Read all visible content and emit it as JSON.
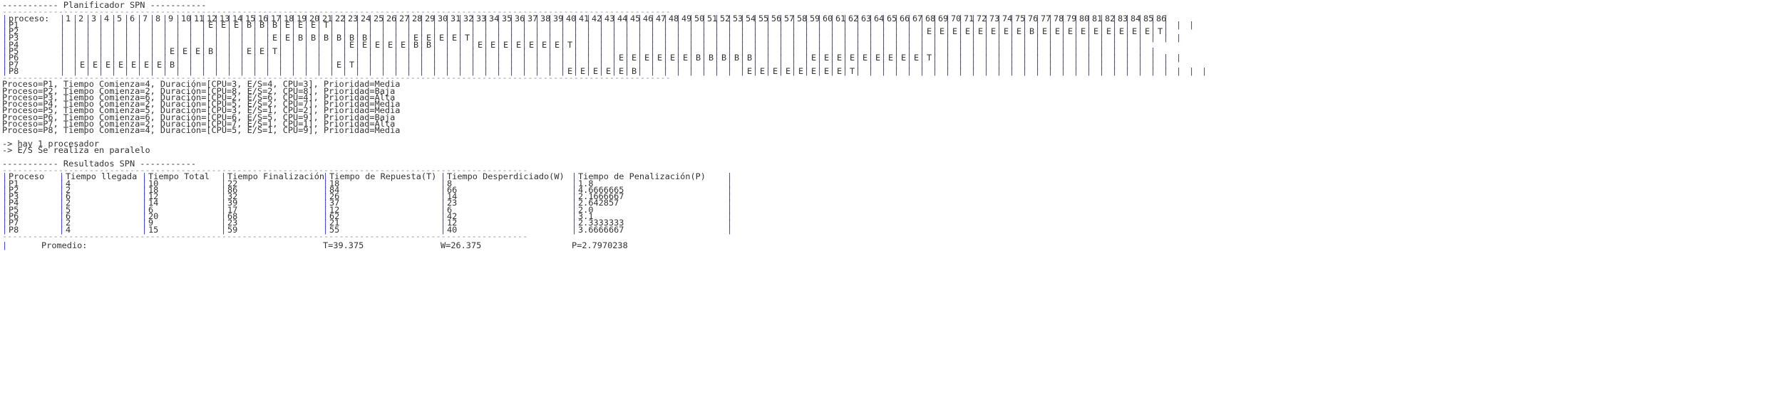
{
  "title_line": "----------- Planificador SPN -----------",
  "gantt": {
    "separator": "-----------------------------------------------------------------------------------------------------------------------------------",
    "header_label": "proceso:",
    "ticks": [
      "1",
      "2",
      "3",
      "4",
      "5",
      "6",
      "7",
      "8",
      "9",
      "10",
      "11",
      "12",
      "13",
      "14",
      "15",
      "16",
      "17",
      "18",
      "19",
      "20",
      "21",
      "22",
      "23",
      "24",
      "25",
      "26",
      "27",
      "28",
      "29",
      "30",
      "31",
      "32",
      "33",
      "34",
      "35",
      "36",
      "37",
      "38",
      "39",
      "40",
      "41",
      "42",
      "43",
      "44",
      "45",
      "46",
      "47",
      "48",
      "49",
      "50",
      "51",
      "52",
      "53",
      "54",
      "55",
      "56",
      "57",
      "58",
      "59",
      "60",
      "61",
      "62",
      "63",
      "64",
      "65",
      "66",
      "67",
      "68",
      "69",
      "70",
      "71",
      "72",
      "73",
      "74",
      "75",
      "76",
      "77",
      "78",
      "79",
      "80",
      "81",
      "82",
      "83",
      "84",
      "85",
      "86"
    ],
    "rows": [
      {
        "name": "P1",
        "cells": [
          "",
          "",
          "",
          "",
          "",
          "",
          "",
          "",
          "",
          "",
          "",
          "E",
          "E",
          "E",
          "B",
          "B",
          "B",
          "E",
          "E",
          "E",
          "T",
          "",
          "",
          "",
          "",
          "",
          "",
          "",
          "",
          "",
          "",
          "",
          "",
          "",
          "",
          "",
          "",
          "",
          "",
          "",
          "",
          "",
          "",
          "",
          "",
          "",
          "",
          "",
          "",
          "",
          "",
          "",
          "",
          "",
          "",
          "",
          "",
          "",
          "",
          "",
          "",
          "",
          "",
          "",
          "",
          "",
          "",
          "",
          "",
          "",
          "",
          "",
          "",
          "",
          "",
          "",
          "",
          "",
          "",
          "",
          "",
          "",
          "",
          "",
          "",
          "",
          "",
          ""
        ]
      },
      {
        "name": "P2",
        "cells": [
          "",
          "",
          "",
          "",
          "",
          "",
          "",
          "",
          "",
          "",
          "",
          "",
          "",
          "",
          "",
          "",
          "",
          "",
          "",
          "",
          "",
          "",
          "",
          "",
          "",
          "",
          "",
          "",
          "",
          "",
          "",
          "",
          "",
          "",
          "",
          "",
          "",
          "",
          "",
          "",
          "",
          "",
          "",
          "",
          "",
          "",
          "",
          "",
          "",
          "",
          "",
          "",
          "",
          "",
          "",
          "",
          "",
          "",
          "",
          "",
          "",
          "",
          "",
          "",
          "",
          "",
          "",
          "E",
          "E",
          "E",
          "E",
          "E",
          "E",
          "E",
          "E",
          "B",
          "E",
          "E",
          "E",
          "E",
          "E",
          "E",
          "E",
          "E",
          "E",
          "T"
        ]
      },
      {
        "name": "P3",
        "cells": [
          "",
          "",
          "",
          "",
          "",
          "",
          "",
          "",
          "",
          "",
          "",
          "",
          "",
          "",
          "",
          "",
          "E",
          "E",
          "B",
          "B",
          "B",
          "B",
          "B",
          "B",
          "",
          "",
          "",
          "E",
          "E",
          "E",
          "E",
          "T",
          "",
          "",
          "",
          "",
          "",
          "",
          "",
          "",
          "",
          "",
          "",
          "",
          "",
          "",
          "",
          "",
          "",
          "",
          "",
          "",
          "",
          "",
          "",
          "",
          "",
          "",
          "",
          "",
          "",
          "",
          "",
          "",
          "",
          "",
          "",
          "",
          "",
          "",
          "",
          "",
          "",
          "",
          "",
          "",
          "",
          "",
          "",
          "",
          "",
          "",
          "",
          "",
          "",
          "",
          ""
        ]
      },
      {
        "name": "P4",
        "cells": [
          "",
          "",
          "",
          "",
          "",
          "",
          "",
          "",
          "",
          "",
          "",
          "",
          "",
          "",
          "",
          "",
          "",
          "",
          "",
          "",
          "",
          "",
          "E",
          "E",
          "E",
          "E",
          "E",
          "B",
          "B",
          "",
          "",
          "",
          "E",
          "E",
          "E",
          "E",
          "E",
          "E",
          "E",
          "T",
          "",
          "",
          "",
          "",
          "",
          "",
          "",
          "",
          "",
          "",
          "",
          "",
          "",
          "",
          "",
          "",
          "",
          "",
          "",
          "",
          "",
          "",
          "",
          "",
          "",
          "",
          "",
          "",
          "",
          "",
          "",
          "",
          "",
          "",
          "",
          "",
          "",
          "",
          "",
          "",
          "",
          "",
          "",
          ""
        ]
      },
      {
        "name": "P5",
        "cells": [
          "",
          "",
          "",
          "",
          "",
          "",
          "",
          "",
          "E",
          "E",
          "E",
          "B",
          "",
          "",
          "E",
          "E",
          "T",
          "",
          "",
          "",
          "",
          "",
          "",
          "",
          "",
          "",
          "",
          "",
          "",
          "",
          "",
          "",
          "",
          "",
          "",
          "",
          "",
          "",
          "",
          "",
          "",
          "",
          "",
          "",
          "",
          "",
          "",
          "",
          "",
          "",
          "",
          "",
          "",
          "",
          "",
          "",
          "",
          "",
          "",
          "",
          "",
          "",
          "",
          "",
          "",
          "",
          "",
          "",
          "",
          "",
          "",
          "",
          "",
          "",
          "",
          "",
          "",
          "",
          "",
          "",
          "",
          "",
          "",
          "",
          ""
        ]
      },
      {
        "name": "P6",
        "cells": [
          "",
          "",
          "",
          "",
          "",
          "",
          "",
          "",
          "",
          "",
          "",
          "",
          "",
          "",
          "",
          "",
          "",
          "",
          "",
          "",
          "",
          "",
          "",
          "",
          "",
          "",
          "",
          "",
          "",
          "",
          "",
          "",
          "",
          "",
          "",
          "",
          "",
          "",
          "",
          "",
          "",
          "",
          "",
          "E",
          "E",
          "E",
          "E",
          "E",
          "E",
          "B",
          "B",
          "B",
          "B",
          "B",
          "",
          "",
          "",
          "",
          "E",
          "E",
          "E",
          "E",
          "E",
          "E",
          "E",
          "E",
          "E",
          "T",
          "",
          "",
          "",
          "",
          "",
          "",
          "",
          "",
          "",
          "",
          "",
          "",
          "",
          "",
          "",
          "",
          "",
          "",
          ""
        ]
      },
      {
        "name": "P7",
        "cells": [
          "",
          "E",
          "E",
          "E",
          "E",
          "E",
          "E",
          "E",
          "B",
          "",
          "",
          "",
          "",
          "",
          "",
          "",
          "",
          "",
          "",
          "",
          "",
          "E",
          "T",
          "",
          "",
          "",
          "",
          "",
          "",
          "",
          "",
          "",
          "",
          "",
          "",
          "",
          "",
          "",
          "",
          "",
          "",
          "",
          "",
          "",
          "",
          "",
          "",
          "",
          "",
          "",
          "",
          "",
          "",
          "",
          "",
          "",
          "",
          "",
          "",
          "",
          "",
          "",
          "",
          "",
          "",
          "",
          "",
          "",
          "",
          "",
          "",
          "",
          "",
          "",
          "",
          "",
          "",
          "",
          "",
          "",
          "",
          "",
          "",
          "",
          "",
          ""
        ]
      },
      {
        "name": "P8",
        "cells": [
          "",
          "",
          "",
          "",
          "",
          "",
          "",
          "",
          "",
          "",
          "",
          "",
          "",
          "",
          "",
          "",
          "",
          "",
          "",
          "",
          "",
          "",
          "",
          "",
          "",
          "",
          "",
          "",
          "",
          "",
          "",
          "",
          "",
          "",
          "",
          "",
          "",
          "",
          "",
          "E",
          "E",
          "E",
          "E",
          "E",
          "B",
          "",
          "",
          "",
          "",
          "",
          "",
          "",
          "",
          "E",
          "E",
          "E",
          "E",
          "E",
          "E",
          "E",
          "E",
          "T",
          "",
          "",
          "",
          "",
          "",
          "",
          "",
          "",
          "",
          "",
          "",
          "",
          "",
          "",
          "",
          "",
          "",
          "",
          "",
          "",
          "",
          "",
          "",
          "",
          "",
          "",
          ""
        ]
      }
    ]
  },
  "process_lines": [
    "Proceso=P1, Tiempo Comienza=4, Duración=[CPU=3, E/S=4, CPU=3], Prioridad=Media",
    "Proceso=P2, Tiempo Comienza=2, Duración=[CPU=8, E/S=2, CPU=8], Prioridad=Baja",
    "Proceso=P3, Tiempo Comienza=6, Duración=[CPU=2, E/S=6, CPU=4], Prioridad=Alta",
    "Proceso=P4, Tiempo Comienza=2, Duración=[CPU=5, E/S=2, CPU=7], Prioridad=Media",
    "Proceso=P5, Tiempo Comienza=5, Duración=[CPU=3, E/S=1, CPU=2], Prioridad=Media",
    "Proceso=P6, Tiempo Comienza=6, Duración=[CPU=6, E/S=5, CPU=9], Prioridad=Baja",
    "Proceso=P7, Tiempo Comienza=2, Duración=[CPU=7, E/S=1, CPU=1], Prioridad=Alta",
    "Proceso=P8, Tiempo Comienza=4, Duración=[CPU=5, E/S=1, CPU=9], Prioridad=Media"
  ],
  "notes": [
    "-> hay 1 procesador",
    "-> E/S Se realiza en paralelo"
  ],
  "results": {
    "title_line": "----------- Resultados SPN -----------",
    "separator": "-------------------------------------------------------------------------------------------------------",
    "headers": [
      "Proceso",
      "Tiempo llegada",
      "Tiempo Total",
      "Tiempo Finalización",
      "Tiempo de Repuesta(T)",
      "Tiempo Desperdiciado(W)",
      "Tiempo de Penalización(P)"
    ],
    "rows": [
      [
        "P1",
        "4",
        "10",
        "22",
        "18",
        "8",
        "1.8"
      ],
      [
        "P2",
        "2",
        "18",
        "86",
        "84",
        "66",
        "4.6666665"
      ],
      [
        "P3",
        "6",
        "12",
        "32",
        "26",
        "14",
        "2.1666667"
      ],
      [
        "P4",
        "2",
        "14",
        "39",
        "37",
        "23",
        "2.642857"
      ],
      [
        "P5",
        "5",
        "6",
        "17",
        "12",
        "6",
        "2.0"
      ],
      [
        "P6",
        "6",
        "20",
        "68",
        "62",
        "42",
        "3.1"
      ],
      [
        "P7",
        "2",
        "9",
        "23",
        "21",
        "12",
        "2.3333333"
      ],
      [
        "P8",
        "4",
        "15",
        "59",
        "55",
        "40",
        "3.6666667"
      ]
    ],
    "average": {
      "label": "Promedio:",
      "T": "T=39.375",
      "W": "W=26.375",
      "P": "P=2.7970238"
    }
  }
}
